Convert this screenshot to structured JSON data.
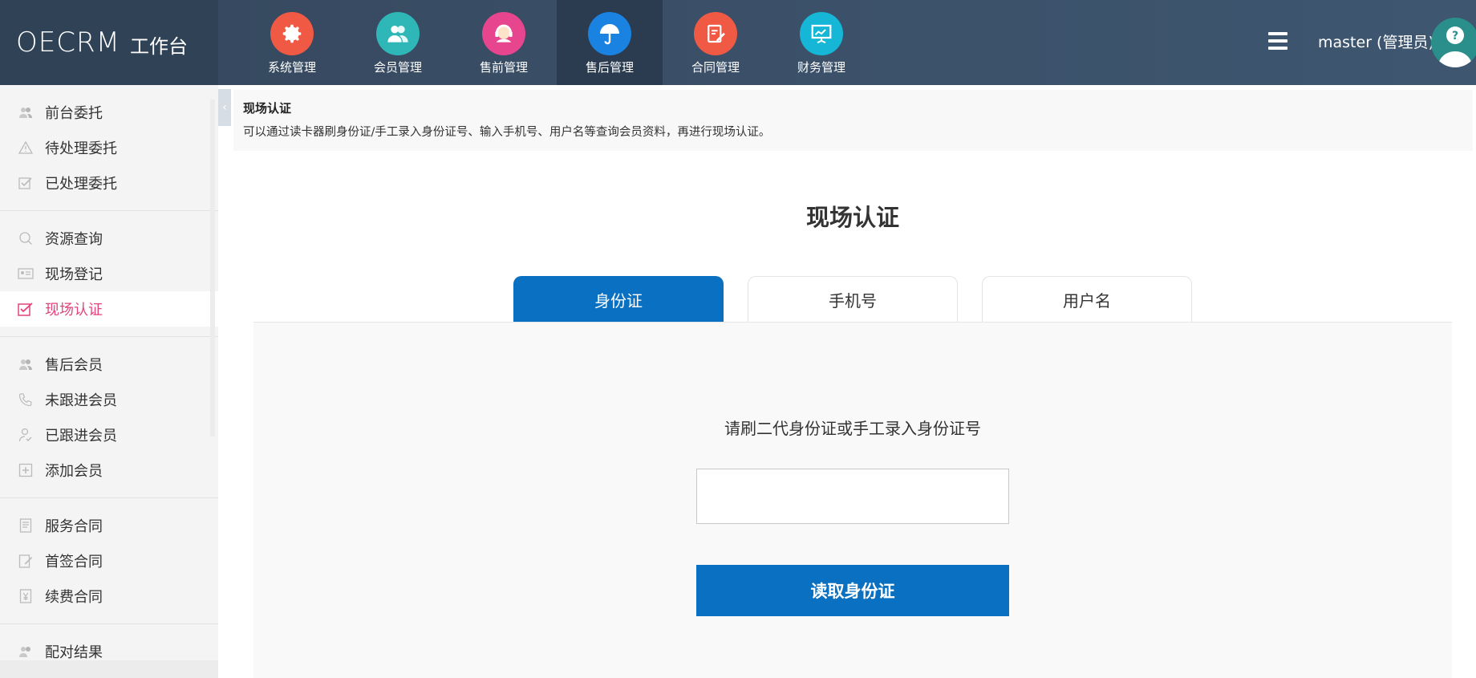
{
  "app": {
    "brand": "OECRM",
    "subtitle": "工作台"
  },
  "nav": [
    {
      "label": "系统管理",
      "color": "#f05a45",
      "icon": "gear-icon"
    },
    {
      "label": "会员管理",
      "color": "#2fb6b7",
      "icon": "users-icon"
    },
    {
      "label": "售前管理",
      "color": "#e8458f",
      "icon": "headset-icon"
    },
    {
      "label": "售后管理",
      "color": "#1a82e0",
      "icon": "umbrella-icon",
      "active": true
    },
    {
      "label": "合同管理",
      "color": "#f05a45",
      "icon": "contract-icon"
    },
    {
      "label": "财务管理",
      "color": "#15b6d6",
      "icon": "presentation-icon"
    }
  ],
  "user": {
    "name": "master (管理员)"
  },
  "sidebar": {
    "groups": [
      [
        {
          "label": "前台委托",
          "icon": "users-icon"
        },
        {
          "label": "待处理委托",
          "icon": "warning-icon"
        },
        {
          "label": "已处理委托",
          "icon": "checkbox-icon"
        }
      ],
      [
        {
          "label": "资源查询",
          "icon": "search-icon"
        },
        {
          "label": "现场登记",
          "icon": "id-card-icon"
        },
        {
          "label": "现场认证",
          "icon": "checkbox-icon",
          "active": true
        }
      ],
      [
        {
          "label": "售后会员",
          "icon": "users-icon"
        },
        {
          "label": "未跟进会员",
          "icon": "phone-icon"
        },
        {
          "label": "已跟进会员",
          "icon": "user-check-icon"
        },
        {
          "label": "添加会员",
          "icon": "plus-box-icon"
        }
      ],
      [
        {
          "label": "服务合同",
          "icon": "document-icon"
        },
        {
          "label": "首签合同",
          "icon": "edit-icon"
        },
        {
          "label": "续费合同",
          "icon": "yen-doc-icon"
        }
      ],
      [
        {
          "label": "配对结果",
          "icon": "users-icon"
        }
      ]
    ]
  },
  "breadcrumb": {
    "title": "现场认证",
    "desc": "可以通过读卡器刷身份证/手工录入身份证号、输入手机号、用户名等查询会员资料，再进行现场认证。"
  },
  "main": {
    "title": "现场认证",
    "tabs": [
      {
        "label": "身份证",
        "active": true
      },
      {
        "label": "手机号"
      },
      {
        "label": "用户名"
      }
    ],
    "prompt": "请刷二代身份证或手工录入身份证号",
    "input_value": "",
    "button_label": "读取身份证"
  },
  "colors": {
    "primary": "#0a70c2",
    "active_sidebar": "#e4437a",
    "topbar": "#34465c"
  }
}
